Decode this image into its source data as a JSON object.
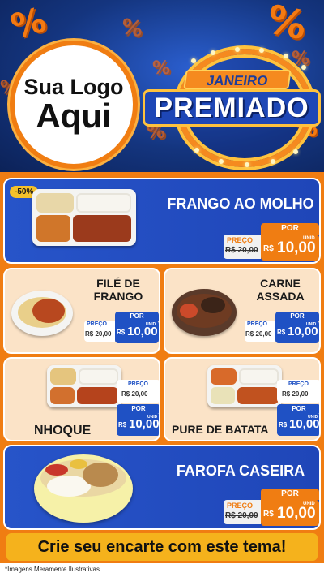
{
  "header": {
    "logo_line1": "Sua Logo",
    "logo_line2": "Aqui",
    "badge_top": "JANEIRO",
    "badge_main": "PREMIADO",
    "percent_symbol": "%"
  },
  "items": [
    {
      "name": "FRANGO AO MOLHO",
      "discount": "-50%",
      "preco_label": "PREÇO",
      "old_price": "R$ 20,00",
      "por_label": "POR",
      "currency": "R$",
      "price": "10,00",
      "unit": "UNID"
    },
    {
      "name_line1": "FILÉ DE",
      "name_line2": "FRANGO",
      "preco_label": "PREÇO",
      "old_price": "R$ 20,00",
      "por_label": "POR",
      "currency": "R$",
      "price": "10,00",
      "unit": "UNID"
    },
    {
      "name_line1": "CARNE",
      "name_line2": "ASSADA",
      "preco_label": "PREÇO",
      "old_price": "R$ 20,00",
      "por_label": "POR",
      "currency": "R$",
      "price": "10,00",
      "unit": "UNID"
    },
    {
      "name": "NHOQUE",
      "preco_label": "PREÇO",
      "old_price": "R$ 20,00",
      "por_label": "POR",
      "currency": "R$",
      "price": "10,00",
      "unit": "UNID"
    },
    {
      "name": "PURE DE BATATA",
      "preco_label": "PREÇO",
      "old_price": "R$ 20,00",
      "por_label": "POR",
      "currency": "R$",
      "price": "10,00",
      "unit": "UNID"
    },
    {
      "name": "FAROFA CASEIRA",
      "preco_label": "PREÇO",
      "old_price": "R$ 20,00",
      "por_label": "POR",
      "currency": "R$",
      "price": "10,00",
      "unit": "UNID"
    }
  ],
  "cta": "Crie seu encarte com este tema!",
  "footer_note": "*Imagens Meramente Ilustrativas",
  "colors": {
    "orange": "#f07d12",
    "blue": "#1f46b8",
    "peach": "#fbe3c7",
    "yellow": "#f5b21c"
  }
}
